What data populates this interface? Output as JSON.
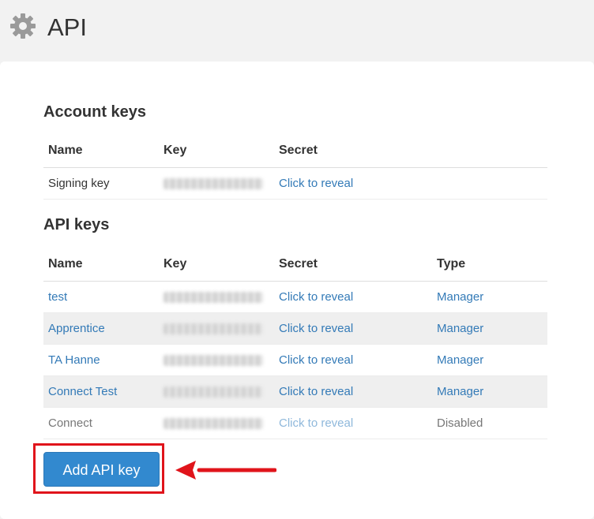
{
  "page": {
    "title": "API",
    "icon": "gear-icon"
  },
  "account_keys": {
    "title": "Account keys",
    "columns": [
      "Name",
      "Key",
      "Secret"
    ],
    "rows": [
      {
        "name": "Signing key",
        "secret": "Click to reveal"
      }
    ]
  },
  "api_keys": {
    "title": "API keys",
    "columns": [
      "Name",
      "Key",
      "Secret",
      "Type"
    ],
    "rows": [
      {
        "name": "test",
        "secret": "Click to reveal",
        "type": "Manager"
      },
      {
        "name": "Apprentice",
        "secret": "Click to reveal",
        "type": "Manager"
      },
      {
        "name": "TA Hanne",
        "secret": "Click to reveal",
        "type": "Manager"
      },
      {
        "name": "Connect Test",
        "secret": "Click to reveal",
        "type": "Manager"
      },
      {
        "name": "Connect",
        "secret": "Click to reveal",
        "type": "Disabled"
      }
    ]
  },
  "actions": {
    "add_label": "Add API key"
  },
  "colors": {
    "link": "#337ab7",
    "button": "#3289cf",
    "highlight": "#e0141b"
  }
}
